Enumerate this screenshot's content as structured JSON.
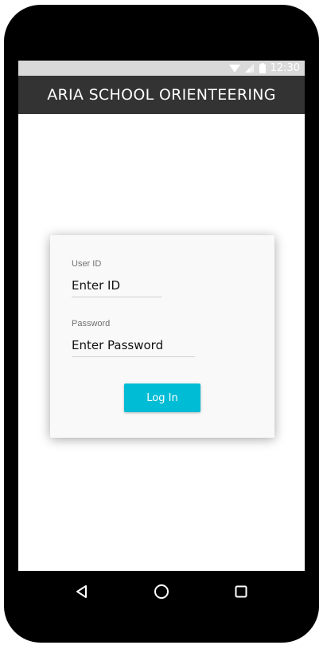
{
  "status_bar": {
    "time": "12:30",
    "icons": [
      "wifi-icon",
      "cell-signal-icon",
      "battery-icon"
    ]
  },
  "app_bar": {
    "title": "ARIA SCHOOL ORIENTEERING"
  },
  "login_form": {
    "user_id": {
      "label": "User ID",
      "value": "Enter ID"
    },
    "password": {
      "label": "Password",
      "value": "Enter Password"
    },
    "login_button_label": "Log In"
  },
  "nav_bar": {
    "buttons": [
      "back-icon",
      "home-icon",
      "recents-icon"
    ]
  },
  "colors": {
    "accent": "#00bcd4",
    "app_bar": "#333333",
    "status_bar": "#d9d9d9",
    "phone_frame": "#000000"
  }
}
